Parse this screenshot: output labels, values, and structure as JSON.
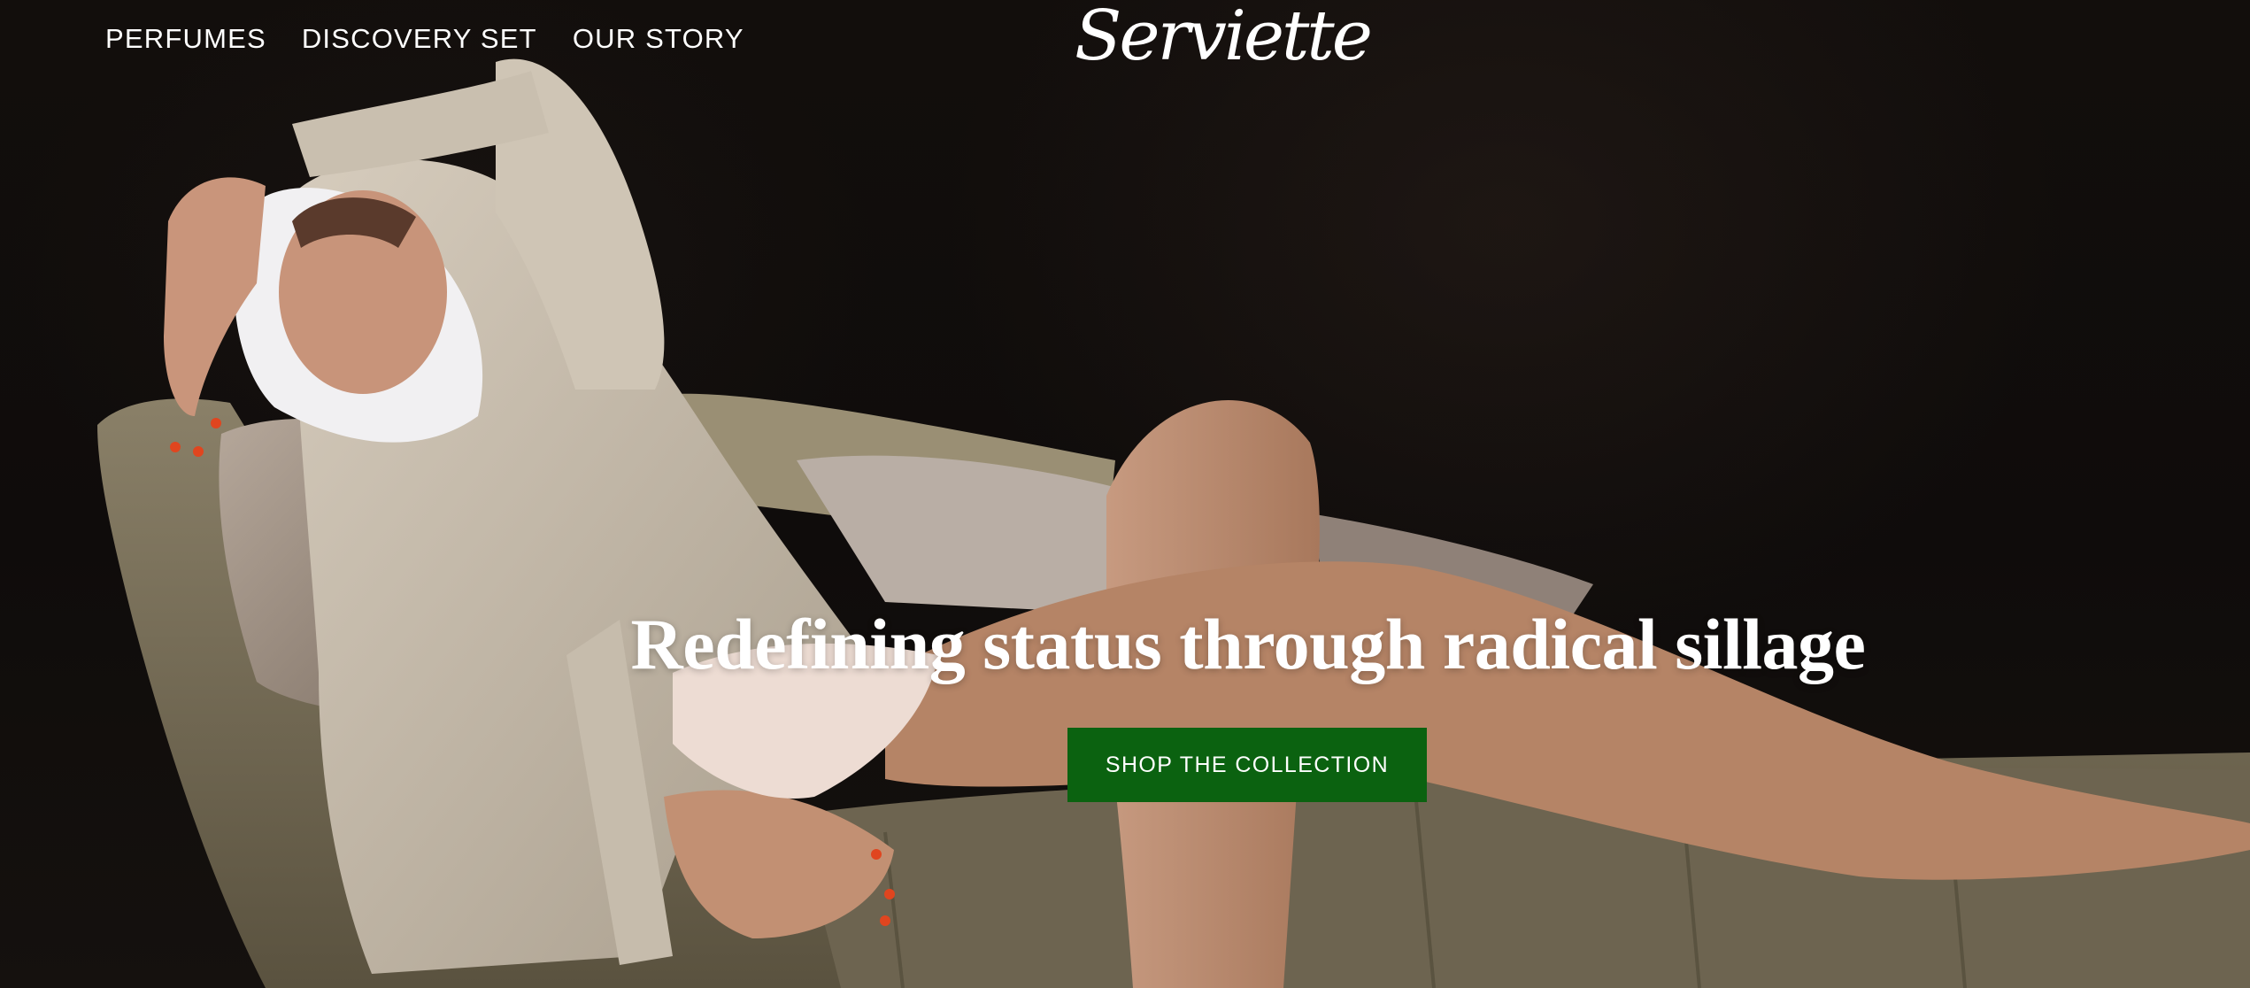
{
  "nav": {
    "links": [
      "PERFUMES",
      "DISCOVERY SET",
      "OUR STORY"
    ]
  },
  "brand": {
    "logo_text": "Serviette"
  },
  "hero": {
    "headline": "Redefining status through radical sillage",
    "cta_label": "SHOP THE COLLECTION",
    "image": "woman reclining on chaise lounge"
  },
  "colors": {
    "background": "#0d0b0a",
    "cta": "#0b6210",
    "text": "#ffffff"
  }
}
